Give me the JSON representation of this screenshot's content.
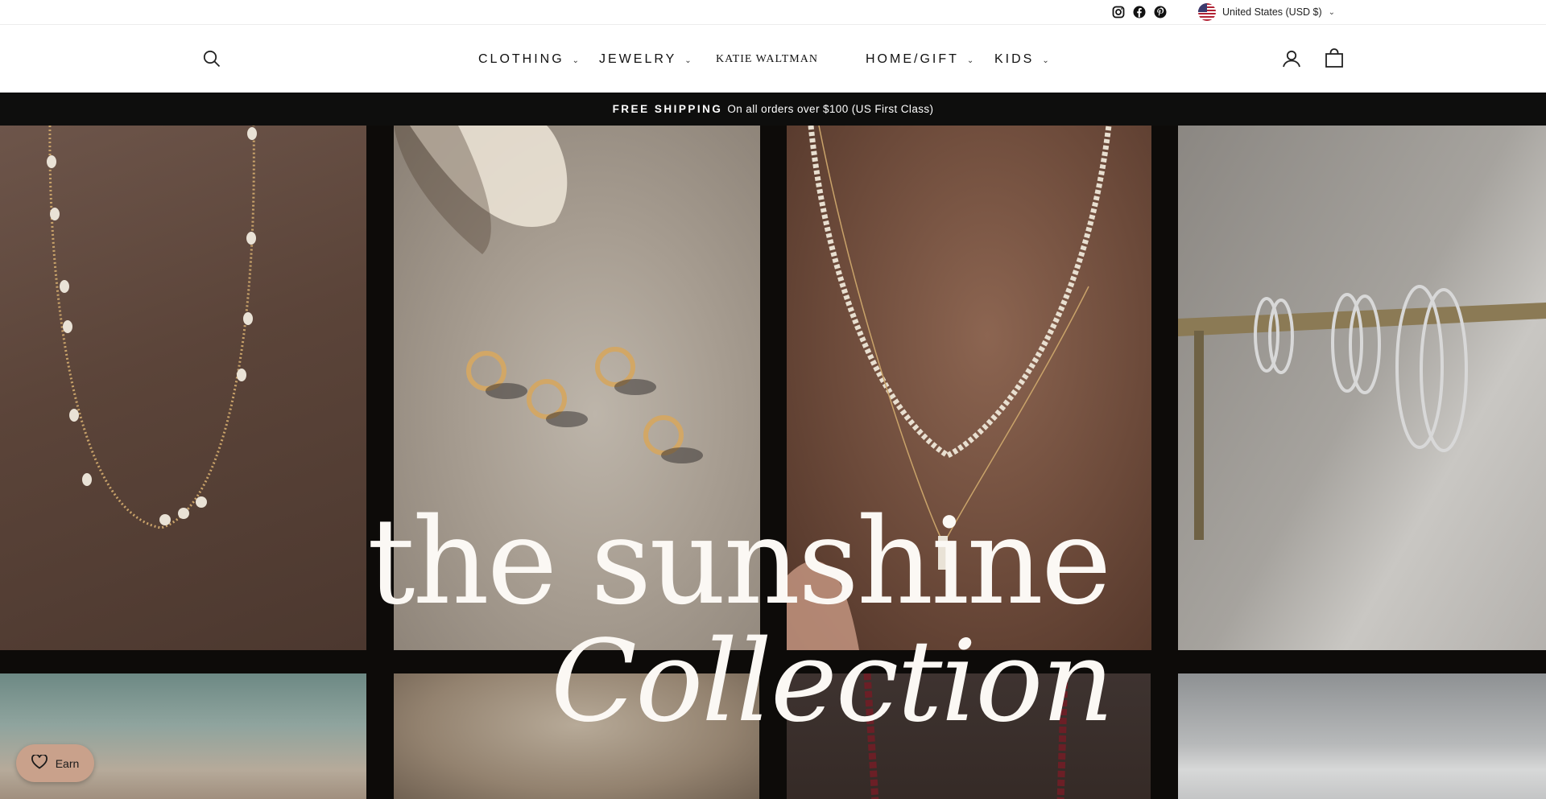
{
  "topbar": {
    "social_icons": [
      "instagram-icon",
      "facebook-icon",
      "pinterest-icon"
    ],
    "currency": {
      "flag_icon": "us-flag-icon",
      "label": "United States (USD $)"
    }
  },
  "header": {
    "nav": [
      {
        "label": "CLOTHING",
        "has_dropdown": true
      },
      {
        "label": "JEWELRY",
        "has_dropdown": true
      },
      {
        "label": "KATIE WALTMAN",
        "has_dropdown": false
      },
      {
        "label": "HOME/GIFT",
        "has_dropdown": true
      },
      {
        "label": "KIDS",
        "has_dropdown": true
      }
    ],
    "icons": [
      "search-icon",
      "account-icon",
      "cart-icon"
    ]
  },
  "announcement": {
    "strong": "FREE SHIPPING",
    "text": "On all orders over $100 (US First Class)"
  },
  "hero": {
    "headline_line1": "the sunshine",
    "headline_line2": "Collection"
  },
  "rewards": {
    "label": "Earn",
    "icon": "heart-icon"
  },
  "colors": {
    "announcement_bg": "#0e0e0d",
    "rewards_bg": "#c9a18b",
    "hero_text": "#fbf8f4"
  }
}
